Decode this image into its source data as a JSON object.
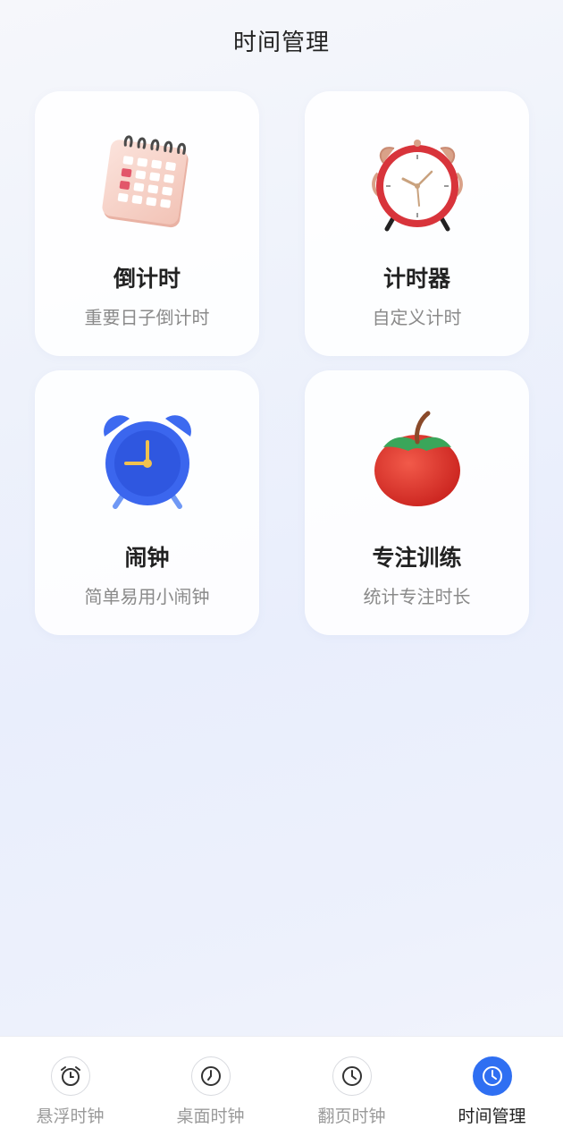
{
  "header": {
    "title": "时间管理"
  },
  "cards": [
    {
      "title": "倒计时",
      "subtitle": "重要日子倒计时",
      "icon": "calendar-icon"
    },
    {
      "title": "计时器",
      "subtitle": "自定义计时",
      "icon": "red-alarm-clock-icon"
    },
    {
      "title": "闹钟",
      "subtitle": "简单易用小闹钟",
      "icon": "blue-alarm-clock-icon"
    },
    {
      "title": "专注训练",
      "subtitle": "统计专注时长",
      "icon": "tomato-icon"
    }
  ],
  "tabs": [
    {
      "label": "悬浮时钟",
      "icon": "alarm-clock-icon",
      "active": false
    },
    {
      "label": "桌面时钟",
      "icon": "clock-icon",
      "active": false
    },
    {
      "label": "翻页时钟",
      "icon": "clock-icon",
      "active": false
    },
    {
      "label": "时间管理",
      "icon": "clock-icon",
      "active": true
    }
  ],
  "colors": {
    "accent": "#2f6ff2",
    "tab_inactive": "#9a9a9a",
    "subtitle": "#8a8a8a"
  }
}
